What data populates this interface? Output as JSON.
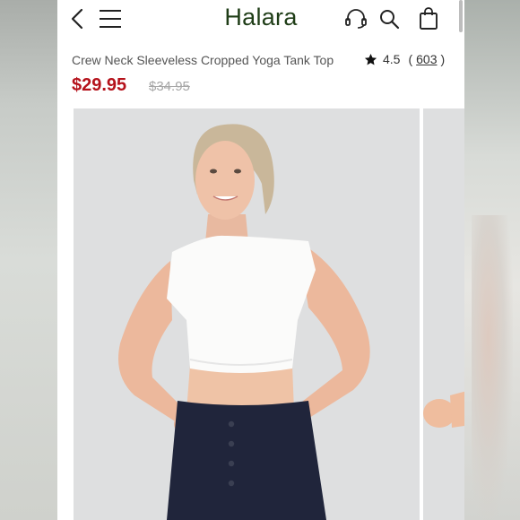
{
  "header": {
    "logo": "Halara",
    "icons": [
      "back-icon",
      "menu-icon",
      "headset-icon",
      "search-icon",
      "bag-icon"
    ]
  },
  "product": {
    "title": "Crew Neck Sleeveless Cropped Yoga Tank Top",
    "rating": "4.5",
    "review_open": "(",
    "review_count": "603",
    "review_close": ")",
    "price": "$29.95",
    "original_price": "$34.95"
  },
  "colors": {
    "brand": "#1f3d17",
    "price": "#b5121b",
    "strike": "#a6a6a6"
  }
}
